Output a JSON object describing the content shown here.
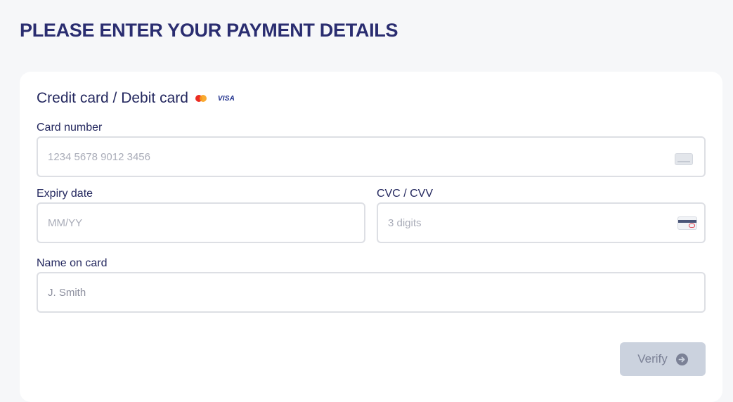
{
  "header": {
    "title": "PLEASE ENTER YOUR PAYMENT DETAILS"
  },
  "payment_method": {
    "title": "Credit card / Debit card",
    "logos": [
      "mastercard-logo",
      "visa-logo"
    ],
    "visa_text": "VISA"
  },
  "form": {
    "card_number": {
      "label": "Card number",
      "placeholder": "1234 5678 9012 3456",
      "value": "",
      "icon": "credit-card-icon"
    },
    "expiry": {
      "label": "Expiry date",
      "placeholder": "MM/YY",
      "value": ""
    },
    "cvc": {
      "label": "CVC / CVV",
      "placeholder": "3 digits",
      "value": "",
      "icon": "card-back-cvv-icon"
    },
    "name": {
      "label": "Name on card",
      "placeholder": "J. Smith",
      "value": ""
    }
  },
  "actions": {
    "verify_label": "Verify",
    "verify_icon": "arrow-right-circle-icon",
    "verify_disabled_color": "#cbd2de"
  },
  "colors": {
    "page_background": "#f6f7f9",
    "title": "#2a2d70",
    "text": "#24285f",
    "field_border": "#dddfe4",
    "placeholder": "#a9acb8"
  }
}
